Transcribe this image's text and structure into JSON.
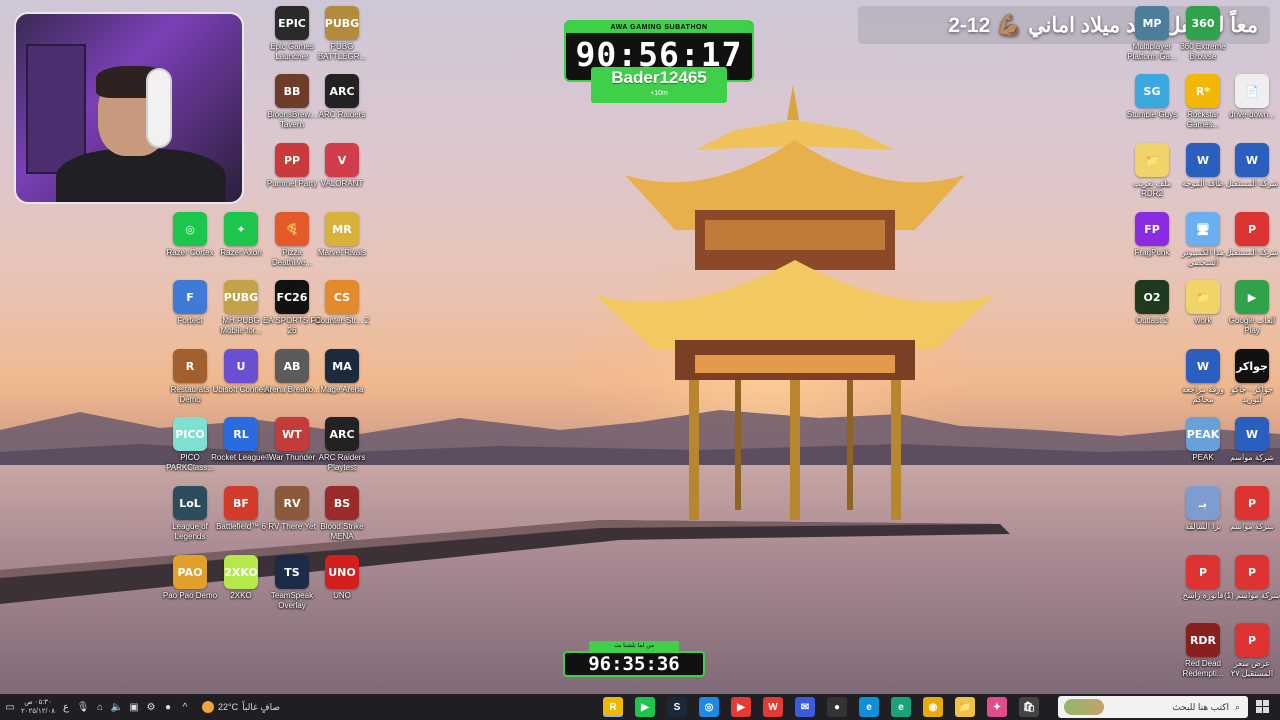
{
  "banner": {
    "text": "معاً لنحتفل بعيد ميلاد اماني 💪🏽 12-2"
  },
  "subathon": {
    "header": "AWA GAMING SUBATHON",
    "time": "90:56:17",
    "user": "Bader12465",
    "increment": "+10m"
  },
  "bottom_timer": {
    "caption": "من لما بلشنا بث",
    "time": "96:35:36"
  },
  "desktop_left": [
    {
      "label": "Epic Games Launcher",
      "text": "EPIC",
      "color": "#2a2a2a"
    },
    {
      "label": "PUBG BATTLEGR...",
      "text": "PUBG",
      "color": "#b38b3c"
    },
    {
      "label": "BloonsBrew... Tavern",
      "text": "BB",
      "color": "#6e3d2a"
    },
    {
      "label": "ARC Raiders",
      "text": "ARC",
      "color": "#222"
    },
    {
      "label": "Pummel Party",
      "text": "PP",
      "color": "#c93a3a"
    },
    {
      "label": "VALORANT",
      "text": "V",
      "color": "#d13d4b"
    },
    {
      "label": "Razer Cortex",
      "text": "◎",
      "color": "#1cc64d"
    },
    {
      "label": "Razer Axon",
      "text": "✦",
      "color": "#1cc64d"
    },
    {
      "label": "Pizza Deathlive...",
      "text": "🍕",
      "color": "#e45a2b"
    },
    {
      "label": "Marvel Rivals",
      "text": "MR",
      "color": "#d8b13a"
    },
    {
      "label": "Fortect",
      "text": "F",
      "color": "#3f7ad6"
    },
    {
      "label": "MH PUBG Mobile for...",
      "text": "PUBG",
      "color": "#c4a24a"
    },
    {
      "label": "EA SPORTS FC 26",
      "text": "FC26",
      "color": "#111"
    },
    {
      "label": "Counter-Str... 2",
      "text": "CS",
      "color": "#e28a2c"
    },
    {
      "label": "Restaurats Demo",
      "text": "R",
      "color": "#a45f2f"
    },
    {
      "label": "Ubisoft Connect",
      "text": "U",
      "color": "#6b4fd1"
    },
    {
      "label": "Arena Breako...",
      "text": "AB",
      "color": "#5b5b5b"
    },
    {
      "label": "Mage Arena",
      "text": "MA",
      "color": "#1b2a3d"
    },
    {
      "label": "PICO PARKClass...",
      "text": "PICO",
      "color": "#7de0d0"
    },
    {
      "label": "Rocket League®",
      "text": "RL",
      "color": "#2a6be0"
    },
    {
      "label": "War Thunder",
      "text": "WT",
      "color": "#c43b3b"
    },
    {
      "label": "ARC Raiders Playtest",
      "text": "ARC",
      "color": "#222"
    },
    {
      "label": "League of Legends",
      "text": "LoL",
      "color": "#2b4d5c"
    },
    {
      "label": "Battlefield™ 6",
      "text": "BF",
      "color": "#d23b2a"
    },
    {
      "label": "RV There Yet",
      "text": "RV",
      "color": "#8b5a3c"
    },
    {
      "label": "Blood Strike MENA",
      "text": "BS",
      "color": "#9b2a2a"
    },
    {
      "label": "Pao Pao Demo",
      "text": "PAO",
      "color": "#e0a02b"
    },
    {
      "label": "2XKO",
      "text": "2XKO",
      "color": "#b5e84a"
    },
    {
      "label": "TeamSpeak Overlay",
      "text": "TS",
      "color": "#1d2b4a"
    },
    {
      "label": "UNO",
      "text": "UNO",
      "color": "#d41f1f"
    }
  ],
  "desktop_right": [
    {
      "label": "Multiplayer Platform Ga...",
      "text": "MP",
      "color": "#4b7d9c"
    },
    {
      "label": "360 Extreme Browse",
      "text": "360",
      "color": "#2fa24b"
    },
    {
      "label": "Stumble Guys",
      "text": "SG",
      "color": "#3ba8e0"
    },
    {
      "label": "Rockstar Games...",
      "text": "R*",
      "color": "#f2b705"
    },
    {
      "label": "drive-down...",
      "text": "📄",
      "color": "#eee"
    },
    {
      "label": "ملف تعريب RDR2",
      "text": "📁",
      "color": "#f0d46a"
    },
    {
      "label": "طاقة الموجة",
      "text": "W",
      "color": "#2b5fbf"
    },
    {
      "label": "شركة المستقبل",
      "text": "W",
      "color": "#2b5fbf"
    },
    {
      "label": "FragPunk",
      "text": "FP",
      "color": "#8a2be2"
    },
    {
      "label": "هذا الكمبيوتر الشخصي",
      "text": "🖥",
      "color": "#6ab0f0"
    },
    {
      "label": "شركة المستقبل",
      "text": "P",
      "color": "#d33"
    },
    {
      "label": "Outlast 2",
      "text": "O2",
      "color": "#1f3a1f"
    },
    {
      "label": "work",
      "text": "📁",
      "color": "#f0d46a"
    },
    {
      "label": "Google ألعاب Play",
      "text": "▶",
      "color": "#2fa24b"
    },
    {
      "label": "ورقة مراجعة محاكم",
      "text": "W",
      "color": "#2b5fbf"
    },
    {
      "label": "جواكر - جاكو لتوريد",
      "text": "جواكر",
      "color": "#111"
    },
    {
      "label": "PEAK",
      "text": "PEAK",
      "color": "#6aa0d8"
    },
    {
      "label": "شركة مواسم",
      "text": "W",
      "color": "#2b5fbf"
    },
    {
      "label": "برا السالفة",
      "text": "بـ",
      "color": "#7f9cd1"
    },
    {
      "label": "شركة مواسم",
      "text": "P",
      "color": "#d33"
    },
    {
      "label": "فاتورة راسخ",
      "text": "P",
      "color": "#d33"
    },
    {
      "label": "شركة مواسم (1)",
      "text": "P",
      "color": "#d33"
    },
    {
      "label": "Red Dead Redempti...",
      "text": "RDR",
      "color": "#8a1f1f"
    },
    {
      "label": "عرض سعر المستقبل ٢٧",
      "text": "P",
      "color": "#d33"
    }
  ],
  "taskbar": {
    "clock_time": "٠٥:٣٠ ص",
    "clock_date": "٢٠٢٥/١٢/٠٨",
    "lang": "ع",
    "weather_temp": "22°C",
    "weather_text": "صافٍ غالباً",
    "search_placeholder": "اكتب هنا للبحث",
    "apps": [
      {
        "name": "rockstar-app",
        "text": "R",
        "color": "#f2b705",
        "active": true
      },
      {
        "name": "greenplay-app",
        "text": "▶",
        "color": "#1cc64d"
      },
      {
        "name": "steam-app",
        "text": "S",
        "color": "#1b2838"
      },
      {
        "name": "browser-app",
        "text": "◎",
        "color": "#1e88e5"
      },
      {
        "name": "media-app",
        "text": "▶",
        "color": "#e53935"
      },
      {
        "name": "wps-app",
        "text": "W",
        "color": "#e53935"
      },
      {
        "name": "messenger-app",
        "text": "✉",
        "color": "#3b5bdb"
      },
      {
        "name": "obs-app",
        "text": "●",
        "color": "#333"
      },
      {
        "name": "edge-app",
        "text": "e",
        "color": "#0f8fd8"
      },
      {
        "name": "edge2-app",
        "text": "e",
        "color": "#1aa37a"
      },
      {
        "name": "chrome-app",
        "text": "◉",
        "color": "#e8a90b"
      },
      {
        "name": "files-app",
        "text": "📁",
        "color": "#f0c24a"
      },
      {
        "name": "pinwheel-app",
        "text": "✦",
        "color": "#e04c8c"
      },
      {
        "name": "store-app",
        "text": "🛍",
        "color": "#444"
      }
    ]
  }
}
